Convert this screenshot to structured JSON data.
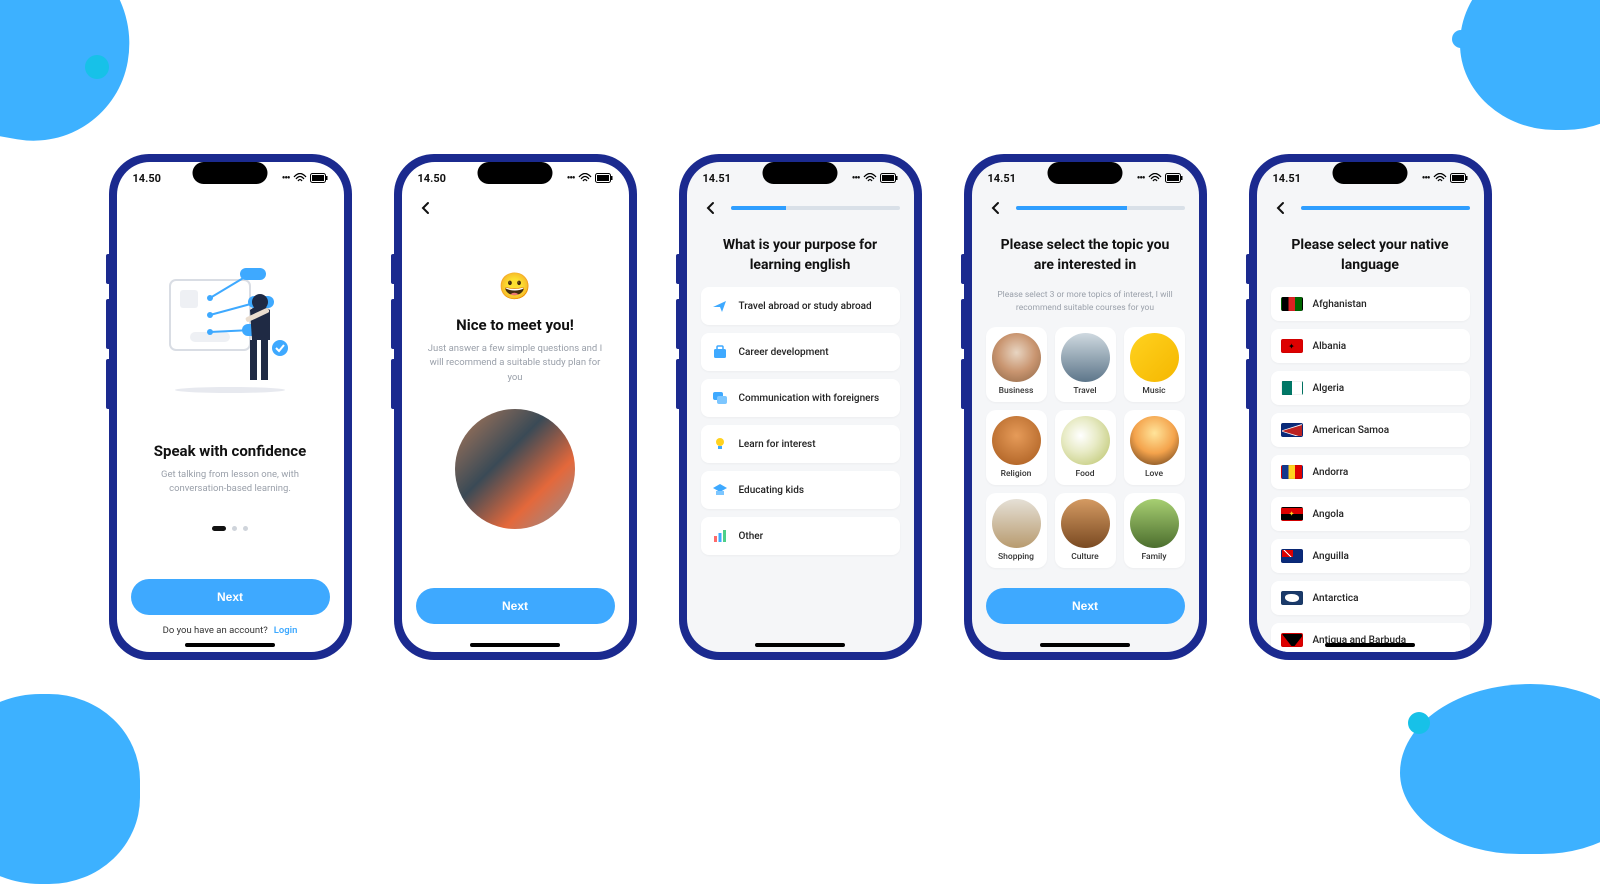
{
  "statusbar": {
    "time1": "14.50",
    "time2": "14.51"
  },
  "screen1": {
    "title": "Speak with confidence",
    "subtitle": "Get talking from lesson one, with conversation-based learning.",
    "next": "Next",
    "login_prompt": "Do you have an account?",
    "login_link": "Login"
  },
  "screen2": {
    "title": "Nice to meet you!",
    "subtitle": "Just answer a few simple questions and I will recommend a suitable study plan for you",
    "next": "Next"
  },
  "screen3": {
    "heading": "What is your purpose for learning english",
    "options": [
      "Travel abroad or study abroad",
      "Career development",
      "Communication with foreigners",
      "Learn for interest",
      "Educating kids",
      "Other"
    ]
  },
  "screen4": {
    "heading": "Please select the topic you are interested in",
    "helper": "Please select 3 or more topics of interest, I will recommend suitable courses for you",
    "topics": [
      "Business",
      "Travel",
      "Music",
      "Religion",
      "Food",
      "Love",
      "Shopping",
      "Culture",
      "Family"
    ],
    "next": "Next"
  },
  "screen5": {
    "heading": "Please select your native language",
    "countries": [
      "Afghanistan",
      "Albania",
      "Algeria",
      "American Samoa",
      "Andorra",
      "Angola",
      "Anguilla",
      "Antarctica",
      "Antigua and Barbuda"
    ]
  }
}
